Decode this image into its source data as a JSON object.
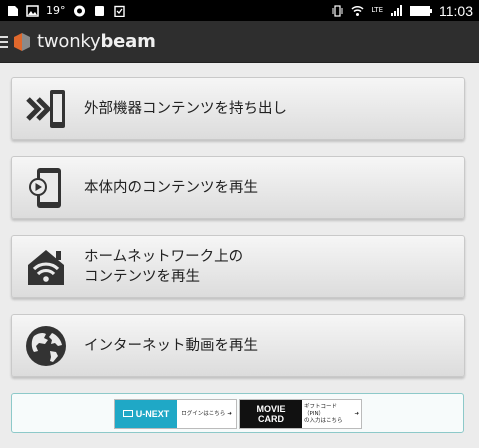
{
  "status_bar": {
    "temperature": "19°",
    "lte": "LTE",
    "time": "11:03"
  },
  "header": {
    "title_light": "twonky",
    "title_bold": "beam"
  },
  "menu": {
    "items": [
      {
        "label": "外部機器コンテンツを持ち出し",
        "icon": "transfer-arrows-icon"
      },
      {
        "label": "本体内のコンテンツを再生",
        "icon": "phone-play-icon"
      },
      {
        "label": "ホームネットワーク上の\nコンテンツを再生",
        "icon": "home-wifi-icon"
      },
      {
        "label": "インターネット動画を再生",
        "icon": "globe-icon"
      }
    ]
  },
  "banner": {
    "unext_logo": "U-NEXT",
    "unext_text": "ログインはこちら",
    "movie_logo_line1": "MOVIE",
    "movie_logo_line2": "CARD",
    "movie_text": "ギフトコード（PIN）\nの入力はこちら",
    "arrow": "➜"
  },
  "colors": {
    "appbar": "#2e2e2e",
    "accent_orange": "#e0682c",
    "banner_border": "#8dc9c9",
    "unext_blue": "#1fa8c6"
  }
}
